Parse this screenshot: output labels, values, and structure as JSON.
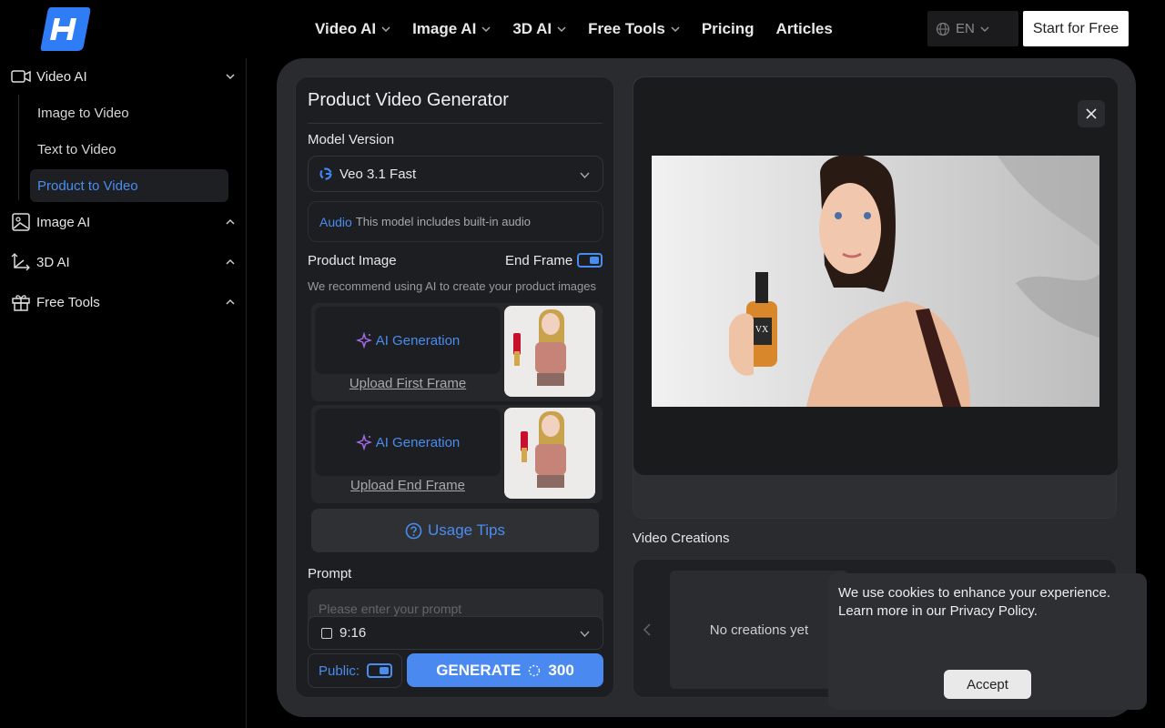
{
  "header": {
    "logo": "H",
    "nav": [
      {
        "label": "Video AI",
        "dropdown": true
      },
      {
        "label": "Image AI",
        "dropdown": true
      },
      {
        "label": "3D AI",
        "dropdown": true
      },
      {
        "label": "Free Tools",
        "dropdown": true
      },
      {
        "label": "Pricing",
        "dropdown": false
      },
      {
        "label": "Articles",
        "dropdown": false
      }
    ],
    "language": "EN",
    "cta": "Start for Free"
  },
  "sidebar": {
    "video_ai": "Video AI",
    "video_items": [
      "Image to Video",
      "Text to Video",
      "Product to Video"
    ],
    "active_item": "Product to Video",
    "image_ai": "Image AI",
    "three_d_ai": "3D AI",
    "free_tools": "Free Tools"
  },
  "form": {
    "title": "Product Video Generator",
    "model_label": "Model Version",
    "model_value": "Veo 3.1 Fast",
    "audio_label": "Audio",
    "audio_desc": "This model includes built-in audio",
    "product_image_label": "Product Image",
    "end_frame_label": "End Frame",
    "end_frame_on": true,
    "recommend": "We recommend using AI to create your product images",
    "ai_generation": "AI Generation",
    "upload_first": "Upload First Frame",
    "upload_end": "Upload End Frame",
    "usage_tips": "Usage Tips",
    "prompt_label": "Prompt",
    "prompt_placeholder": "Please enter your prompt",
    "ratio": "9:16",
    "public_label": "Public:",
    "public_on": true,
    "generate_label": "GENERATE",
    "credits": "300"
  },
  "preview": {
    "product_text": "VX"
  },
  "creations": {
    "title": "Video Creations",
    "empty": "No creations yet"
  },
  "cookie": {
    "text": "We use cookies to enhance your experience. Learn more in our Privacy Policy.",
    "accept": "Accept"
  },
  "colors": {
    "accent": "#4a8df0",
    "background": "#000000",
    "panel": "#2a2b2e"
  }
}
